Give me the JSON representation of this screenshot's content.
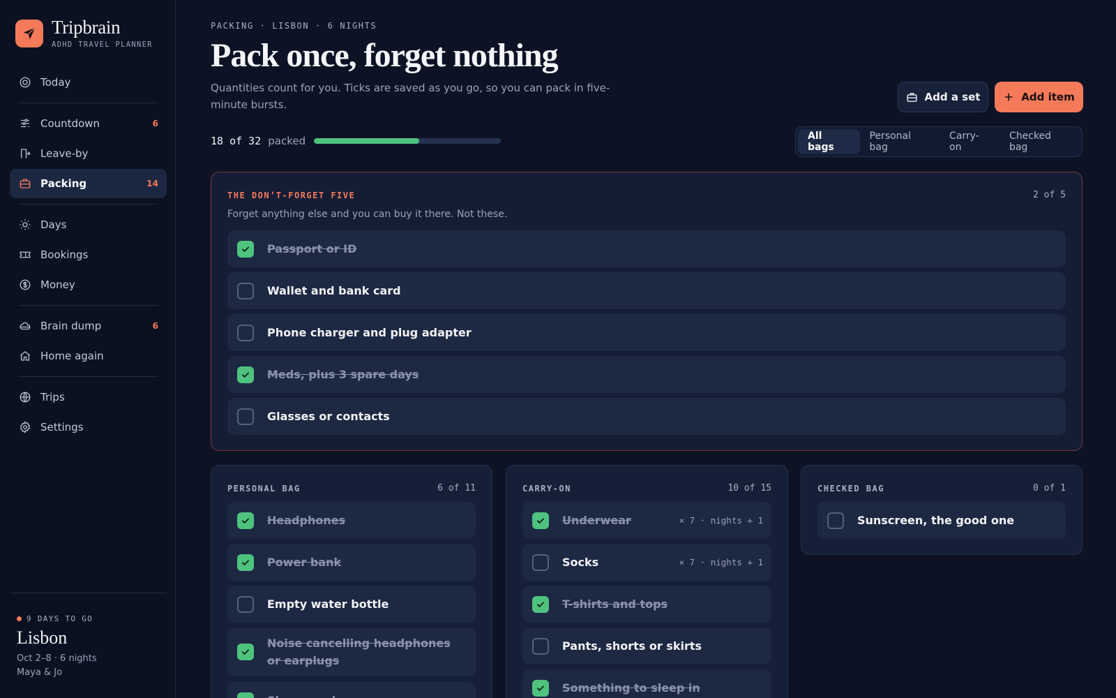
{
  "app": {
    "name": "Tripbrain",
    "tagline": "ADHD TRAVEL PLANNER",
    "accent": "#f47a5a",
    "success": "#4fc27e"
  },
  "nav": {
    "today": {
      "label": "Today",
      "icon": "target-icon"
    },
    "countdown": {
      "label": "Countdown",
      "count": "6",
      "icon": "sliders-icon"
    },
    "leaveby": {
      "label": "Leave-by",
      "icon": "door-exit-icon"
    },
    "packing": {
      "label": "Packing",
      "count": "14",
      "icon": "suitcase-icon"
    },
    "days": {
      "label": "Days",
      "icon": "sun-icon"
    },
    "bookings": {
      "label": "Bookings",
      "icon": "ticket-icon"
    },
    "money": {
      "label": "Money",
      "icon": "dollar-icon"
    },
    "braindump": {
      "label": "Brain dump",
      "count": "6",
      "icon": "cloud-icon"
    },
    "homeagain": {
      "label": "Home again",
      "icon": "home-icon"
    },
    "trips": {
      "label": "Trips",
      "icon": "globe-icon"
    },
    "settings": {
      "label": "Settings",
      "icon": "gear-icon"
    }
  },
  "trip": {
    "countdown": "9 DAYS TO GO",
    "city": "Lisbon",
    "dates": "Oct 2–8 · 6 nights",
    "travelers": "Maya & Jo"
  },
  "header": {
    "eyebrow": "PACKING · LISBON · 6 NIGHTS",
    "title": "Pack once, forget nothing",
    "subtitle": "Quantities count for you. Ticks are saved as you go, so you can pack in five-minute bursts.",
    "add_set": "Add a set",
    "add_item": "Add item"
  },
  "progress": {
    "text": "18 of 32",
    "label": "packed",
    "fraction": 0.5625
  },
  "filters": [
    "All bags",
    "Personal bag",
    "Carry-on",
    "Checked bag"
  ],
  "active_filter": "All bags",
  "dont_forget": {
    "title": "THE DON’T-FORGET FIVE",
    "count": "2 of 5",
    "description": "Forget anything else and you can buy it there. Not these.",
    "items": [
      {
        "label": "Passport or ID",
        "checked": true
      },
      {
        "label": "Wallet and bank card",
        "checked": false
      },
      {
        "label": "Phone charger and plug adapter",
        "checked": false
      },
      {
        "label": "Meds, plus 3 spare days",
        "checked": true
      },
      {
        "label": "Glasses or contacts",
        "checked": false
      }
    ]
  },
  "personal_bag": {
    "title": "PERSONAL BAG",
    "count": "6 of 11",
    "items": [
      {
        "label": "Headphones",
        "checked": true
      },
      {
        "label": "Power bank",
        "checked": true
      },
      {
        "label": "Empty water bottle",
        "checked": false
      },
      {
        "label": "Noise cancelling headphones or earplugs",
        "checked": true
      },
      {
        "label": "Sleep mask",
        "checked": true
      }
    ]
  },
  "carry_on": {
    "title": "CARRY-ON",
    "count": "10 of 15",
    "items": [
      {
        "label": "Underwear",
        "checked": true,
        "qty": "× 7 · nights + 1"
      },
      {
        "label": "Socks",
        "checked": false,
        "qty": "× 7 · nights + 1"
      },
      {
        "label": "T-shirts and tops",
        "checked": true
      },
      {
        "label": "Pants, shorts or skirts",
        "checked": false
      },
      {
        "label": "Something to sleep in",
        "checked": true
      }
    ]
  },
  "checked_bag": {
    "title": "CHECKED BAG",
    "count": "0 of 1",
    "items": [
      {
        "label": "Sunscreen, the good one",
        "checked": false
      }
    ]
  }
}
